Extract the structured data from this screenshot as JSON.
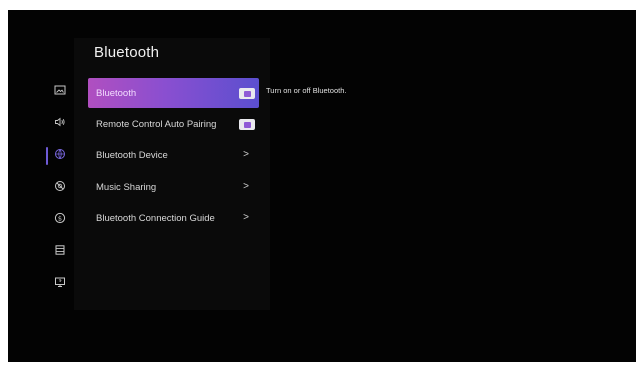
{
  "page": {
    "title": "Bluetooth"
  },
  "sidebar": {
    "items": [
      {
        "icon": "picture-icon",
        "active": false
      },
      {
        "icon": "sound-icon",
        "active": false
      },
      {
        "icon": "globe-network-icon",
        "active": true
      },
      {
        "icon": "accessibility-icon",
        "active": false
      },
      {
        "icon": "dollar-icon",
        "active": false
      },
      {
        "icon": "list-icon",
        "active": false
      },
      {
        "icon": "support-screen-icon",
        "active": false
      }
    ],
    "accent_color": "#6e5bd6"
  },
  "menu": {
    "items": [
      {
        "label": "Bluetooth",
        "type": "toggle",
        "on": true,
        "selected": true
      },
      {
        "label": "Remote Control Auto Pairing",
        "type": "toggle",
        "on": true,
        "selected": false
      },
      {
        "label": "Bluetooth Device",
        "type": "submenu",
        "chevron": ">"
      },
      {
        "label": "Music Sharing",
        "type": "submenu",
        "chevron": ">"
      },
      {
        "label": "Bluetooth Connection Guide",
        "type": "submenu",
        "chevron": ">"
      }
    ],
    "highlight_colors": [
      "#b04fc0",
      "#5b4fcf"
    ]
  },
  "help": {
    "text": "Turn on or off Bluetooth."
  }
}
